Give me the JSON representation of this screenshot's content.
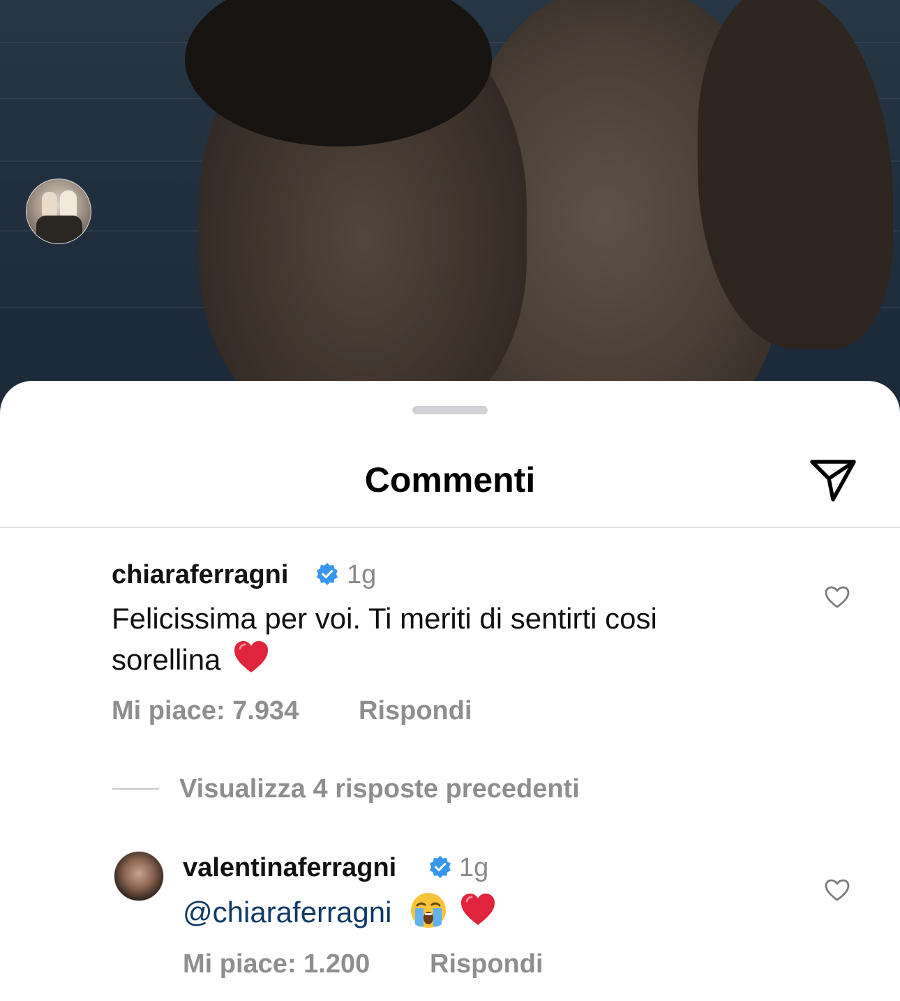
{
  "sheet": {
    "title": "Commenti",
    "share_icon": "send-icon"
  },
  "comments": [
    {
      "username": "chiaraferragni",
      "verified": true,
      "time": "1g",
      "text": "Felicissima per voi. Ti meriti di sentirti cosi sorellina",
      "text_line1": "Felicissima per voi. Ti meriti di sentirti cosi",
      "text_line2": "sorellina",
      "emoji": "red-heart-emoji",
      "likes_label": "Mi piace: 7.934",
      "reply_label": "Rispondi"
    }
  ],
  "replies": {
    "toggle_label": "Visualizza 4 risposte precedenti",
    "items": [
      {
        "username": "valentinaferragni",
        "verified": true,
        "time": "1g",
        "mention": "@chiaraferragni",
        "emojis": [
          "loudly-crying-face-emoji",
          "red-heart-emoji"
        ],
        "likes_label": "Mi piace: 1.200",
        "reply_label": "Rispondi"
      }
    ]
  },
  "colors": {
    "verified_badge": "#3797f0",
    "heart_emoji": "#e0243b",
    "mention": "#0e3a66",
    "secondary_text": "#8e8e8e"
  }
}
